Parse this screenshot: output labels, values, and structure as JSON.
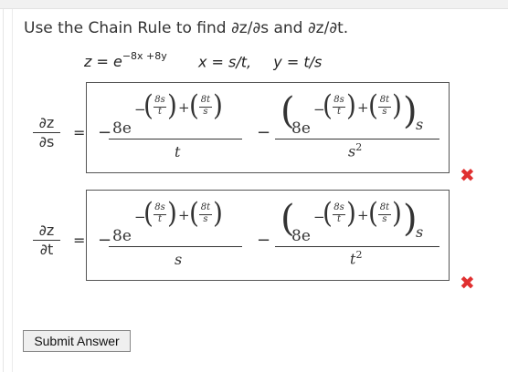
{
  "prompt": "Use the Chain Rule to find ∂z/∂s and ∂z/∂t.",
  "given": {
    "z_lhs": "z = e",
    "z_exp": "−8x +8y",
    "x": "x = s/t,",
    "y": "y = t/s"
  },
  "answers": [
    {
      "lhs_num": "∂z",
      "lhs_den": "∂s",
      "eq": "=",
      "coef": "8e",
      "denominator_1": "t",
      "denominator_2": "s",
      "denominator_2_power": "2",
      "trailing_var": "s",
      "inner_num_a": "8s",
      "inner_den_a": "t",
      "inner_num_b": "8t",
      "inner_den_b": "s",
      "minus": "−",
      "plus": "+",
      "status": "incorrect",
      "mark": "✖"
    },
    {
      "lhs_num": "∂z",
      "lhs_den": "∂t",
      "eq": "=",
      "coef": "8e",
      "denominator_1": "s",
      "denominator_2": "t",
      "denominator_2_power": "2",
      "trailing_var": "s",
      "inner_num_a": "8s",
      "inner_den_a": "t",
      "inner_num_b": "8t",
      "inner_den_b": "s",
      "minus": "−",
      "plus": "+",
      "status": "incorrect",
      "mark": "✖"
    }
  ],
  "submit_label": "Submit Answer",
  "colors": {
    "error": "#e03030",
    "border": "#555555"
  }
}
